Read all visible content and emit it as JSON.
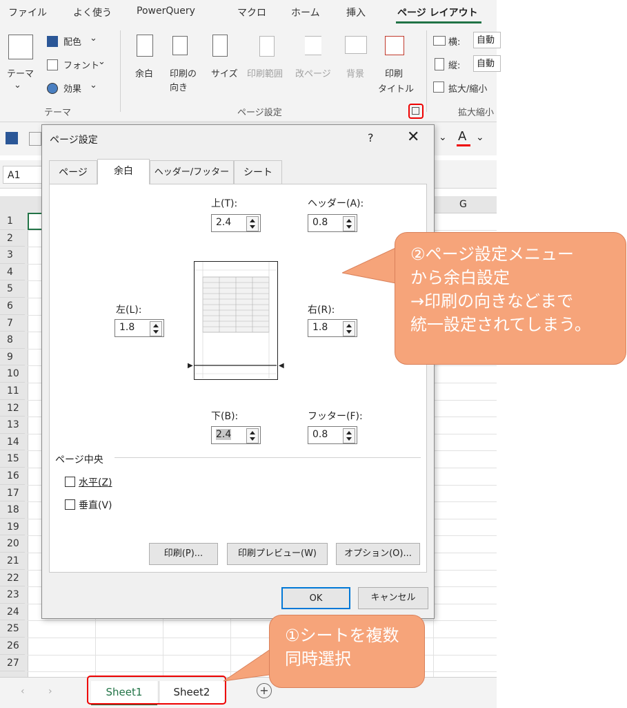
{
  "ribbon": {
    "tabs": [
      "ファイル",
      "よく使う",
      "PowerQuery",
      "マクロ",
      "ホーム",
      "挿入",
      "ページ レイアウト"
    ],
    "theme": {
      "theme_label": "テーマ",
      "colors": "配色",
      "fonts": "フォント",
      "effects": "効果",
      "group_label": "テーマ"
    },
    "page_setup": {
      "margins": "余白",
      "orientation_1": "印刷の",
      "orientation_2": "向き",
      "size": "サイズ",
      "print_area": "印刷範囲",
      "breaks": "改ページ",
      "background": "背景",
      "titles_1": "印刷",
      "titles_2": "タイトル",
      "group_label": "ページ設定"
    },
    "scale": {
      "width": "横:",
      "width_val": "自動",
      "height": "縦:",
      "height_val": "自動",
      "scale": "拡大/縮小",
      "group_label": "拡大縮小"
    }
  },
  "sheet": {
    "name_box": "A1",
    "col_g": "G",
    "rows": [
      "1",
      "2",
      "3",
      "4",
      "5",
      "6",
      "7",
      "8",
      "9",
      "10",
      "11",
      "12",
      "13",
      "14",
      "15",
      "16",
      "17",
      "18",
      "19",
      "20",
      "21",
      "22",
      "23",
      "24",
      "25",
      "26",
      "27"
    ],
    "tabs": [
      "Sheet1",
      "Sheet2"
    ],
    "accent": "#217346"
  },
  "dialog": {
    "title": "ページ設定",
    "help": "?",
    "close": "✕",
    "tabs": [
      "ページ",
      "余白",
      "ヘッダー/フッター",
      "シート"
    ],
    "top_label": "上(T):",
    "top_value": "2.4",
    "header_label": "ヘッダー(A):",
    "header_value": "0.8",
    "left_label": "左(L):",
    "left_value": "1.8",
    "right_label": "右(R):",
    "right_value": "1.8",
    "bottom_label": "下(B):",
    "bottom_value": "2.4",
    "footer_label": "フッター(F):",
    "footer_value": "0.8",
    "center_label": "ページ中央",
    "horizontal": "水平(Z)",
    "vertical": "垂直(V)",
    "print_btn": "印刷(P)...",
    "preview_btn": "印刷プレビュー(W)",
    "options_btn": "オプション(O)...",
    "ok": "OK",
    "cancel": "キャンセル"
  },
  "callouts": {
    "menu_1": "②ページ設定メニュー",
    "menu_2": "から余白設定",
    "menu_3": "→印刷の向きなどまで",
    "menu_4": "統一設定されてしまう。",
    "sheets_1": "①シートを複数",
    "sheets_2": "同時選択"
  }
}
